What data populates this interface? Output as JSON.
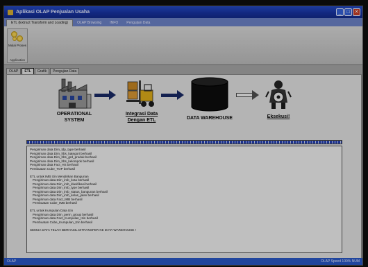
{
  "window": {
    "title": "Aplikasi OLAP Penjualan Usaha",
    "controls": [
      "_",
      "□",
      "✕"
    ]
  },
  "ribbon_tabs": [
    {
      "label": "ETL (Extract Transform and Loading)",
      "active": true
    },
    {
      "label": "OLAP Browsing",
      "active": false
    },
    {
      "label": "INFO",
      "active": false
    },
    {
      "label": "Pengujian Data",
      "active": false
    }
  ],
  "ribbon": {
    "button_label": "Mulai Proses",
    "group_label": "Application"
  },
  "doc_tabs": [
    {
      "label": "OLAP",
      "active": false
    },
    {
      "label": "ETL",
      "active": true
    },
    {
      "label": "Grafik",
      "active": false
    },
    {
      "label": "Pengujian Data",
      "active": false
    }
  ],
  "flow": {
    "source_label_1": "OPERATIONAL",
    "source_label_2": "SYSTEM",
    "etl_label_1": "Integrasi Data",
    "etl_label_2": "Dengan ETL",
    "warehouse_label": "DATA WAREHOUSE",
    "execute_label": "Eksekusi!"
  },
  "progress": {
    "value": 1.0
  },
  "log": {
    "lines": [
      "Pengiriman data Dim_tdp_type berhasil",
      "Pengiriman data Dim_hbs_kategori berhasil",
      "Pengiriman data Dim_hbs_grd_produk berhasil",
      "Pengiriman data Dim_hbs_kelompok berhasil",
      "Pengiriman data Fact_HS berhasil",
      "Pembuatan Cube_TOP berhasil",
      "",
      "ETL untuk IMB Izin Mendirikan Bangunan",
      "   Pengiriman data Dim_imb_kota berhasil",
      "   Pengiriman data Dim_imb_klasifikasi berhasil",
      "   Pengiriman data Dim_imb_type berhasil",
      "   Pengiriman data Dim_imb_status_bangunan berhasil",
      "   Pengiriman data Dim_imb_kelas_jalan berhasil",
      "   Pengiriman data Fact_IMB berhasil",
      "   Pembuatan Cube_IMB berhasil",
      "",
      "ETL untuk Kumpulan Data Izin",
      "   Pengiriman data Dim_perm_group berhasil",
      "   Pengiriman data Fact_Kumpulan_Izin berhasil",
      "   Pembuatan Cube_Kumpulan_Izin berhasil",
      "",
      "SEMUA DATA TELAH BERHASIL DITRANSFER KE DATA WAREHOUSE !"
    ]
  },
  "status": {
    "left": "OLAP",
    "right": "OLAP  Speed  100%  NUM"
  },
  "colors": {
    "title_bar": "#1d38a3",
    "arrow": "#1f2f6a",
    "progress": "#2b46b8",
    "cylinder": "#1a1a1a"
  }
}
